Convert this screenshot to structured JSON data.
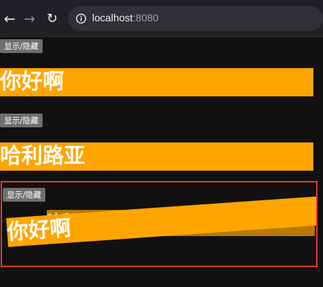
{
  "browser": {
    "url_host": "localhost",
    "url_port": ":8080",
    "icons": {
      "back": "back-arrow-icon",
      "forward": "forward-arrow-icon",
      "reload": "reload-icon",
      "info": "info-icon"
    }
  },
  "sections": [
    {
      "toggle_label": "显示/隐藏",
      "banner_text": "你好啊"
    },
    {
      "toggle_label": "显示/隐藏",
      "banner_text": "哈利路亚"
    },
    {
      "toggle_label": "显示/隐藏",
      "fading_text": "哈利路亚",
      "entering_text": "你好啊"
    }
  ],
  "colors": {
    "page_background": "#111111",
    "banner": "#ffa500",
    "highlight_border": "#e53935",
    "button_background": "#6f6f6f"
  }
}
